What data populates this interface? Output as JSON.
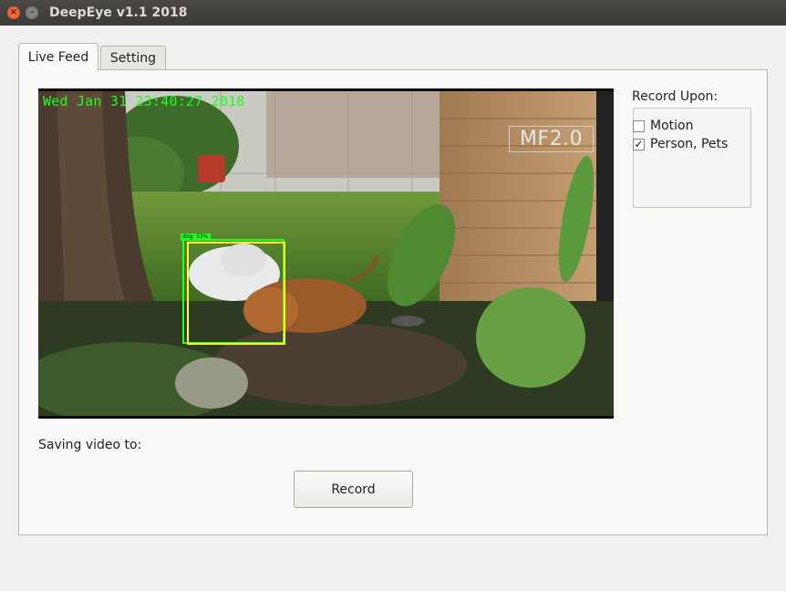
{
  "window": {
    "title": "DeepEye v1.1 2018",
    "close_glyph": "×",
    "minimize_glyph": "–"
  },
  "tabs": [
    {
      "label": "Live Feed",
      "active": true
    },
    {
      "label": "Setting",
      "active": false
    }
  ],
  "video": {
    "timestamp": "Wed Jan 31 23:40:27 2018",
    "watermark": "MF2.0",
    "detection_label": "dog: 53%"
  },
  "record_upon": {
    "label": "Record Upon:",
    "options": [
      {
        "label": "Motion",
        "checked": false,
        "mark": ""
      },
      {
        "label": "Person, Pets",
        "checked": true,
        "mark": "✓"
      }
    ]
  },
  "saving": {
    "label": "Saving video to:"
  },
  "record_button": {
    "label": "Record"
  },
  "colors": {
    "accent_close": "#e95420",
    "titlebar": "#3c3b37",
    "detection_green": "#22ff22",
    "detection_yellow": "#ffff22",
    "timestamp_green": "#1eff1e"
  }
}
